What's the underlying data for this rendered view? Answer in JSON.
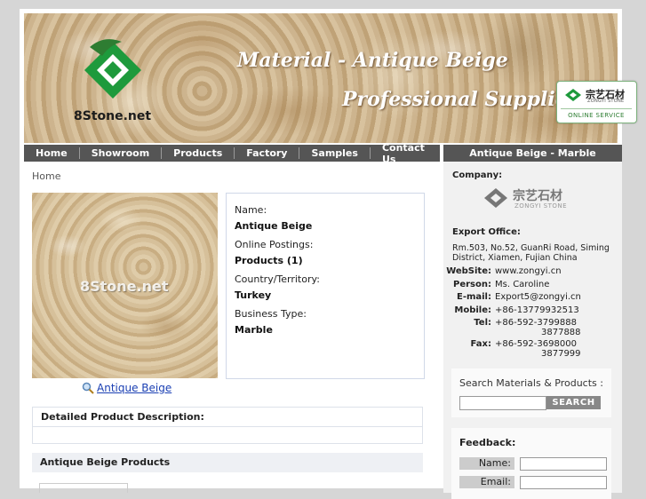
{
  "banner": {
    "logo_text": "8Stone.net",
    "line1": "Material - Antique Beige",
    "line2": "Professional Supplier Of"
  },
  "online_badge": {
    "brand_cn": "宗艺石材",
    "brand_en": "ZONGYI STONE",
    "service": "ONLINE SERVICE"
  },
  "nav": {
    "items": [
      "Home",
      "Showroom",
      "Products",
      "Factory",
      "Samples",
      "Contact Us"
    ],
    "right_title": "Antique Beige - Marble"
  },
  "breadcrumb": "Home",
  "product": {
    "watermark": "8Stone.net",
    "caption": "Antique Beige",
    "info": [
      {
        "label": "Name:",
        "value": "Antique Beige"
      },
      {
        "label": "Online Postings:",
        "value": "Products (1)"
      },
      {
        "label": "Country/Territory:",
        "value": "Turkey"
      },
      {
        "label": "Business Type:",
        "value": "Marble"
      }
    ]
  },
  "description": {
    "header": "Detailed Product Description:"
  },
  "products_section": {
    "header": "Antique Beige Products"
  },
  "sidebar": {
    "company_label": "Company:",
    "brand_cn": "宗艺石材",
    "brand_en": "ZONGYI STONE",
    "export_label": "Export Office:",
    "address": "Rm.503, No.52, GuanRi Road, Siming District, Xiamen, Fujian China",
    "contacts": [
      {
        "key": "WebSite:",
        "value": "www.zongyi.cn"
      },
      {
        "key": "Person:",
        "value": "Ms. Caroline"
      },
      {
        "key": "E-mail:",
        "value": "Export5@zongyi.cn"
      },
      {
        "key": "Mobile:",
        "value": "+86-13779932513"
      },
      {
        "key": "Tel:",
        "value": "+86-592-3799888",
        "extra": "3877888"
      },
      {
        "key": "Fax:",
        "value": "+86-592-3698000",
        "extra": "3877999"
      }
    ],
    "search": {
      "title": "Search Materials & Products :",
      "button": "SEARCH",
      "value": ""
    },
    "feedback": {
      "title": "Feedback:",
      "name_label": "Name:",
      "email_label": "Email:"
    }
  },
  "colors": {
    "nav_bg": "#555555",
    "link": "#1a3fb3",
    "logo_green": "#1e9a3c"
  }
}
